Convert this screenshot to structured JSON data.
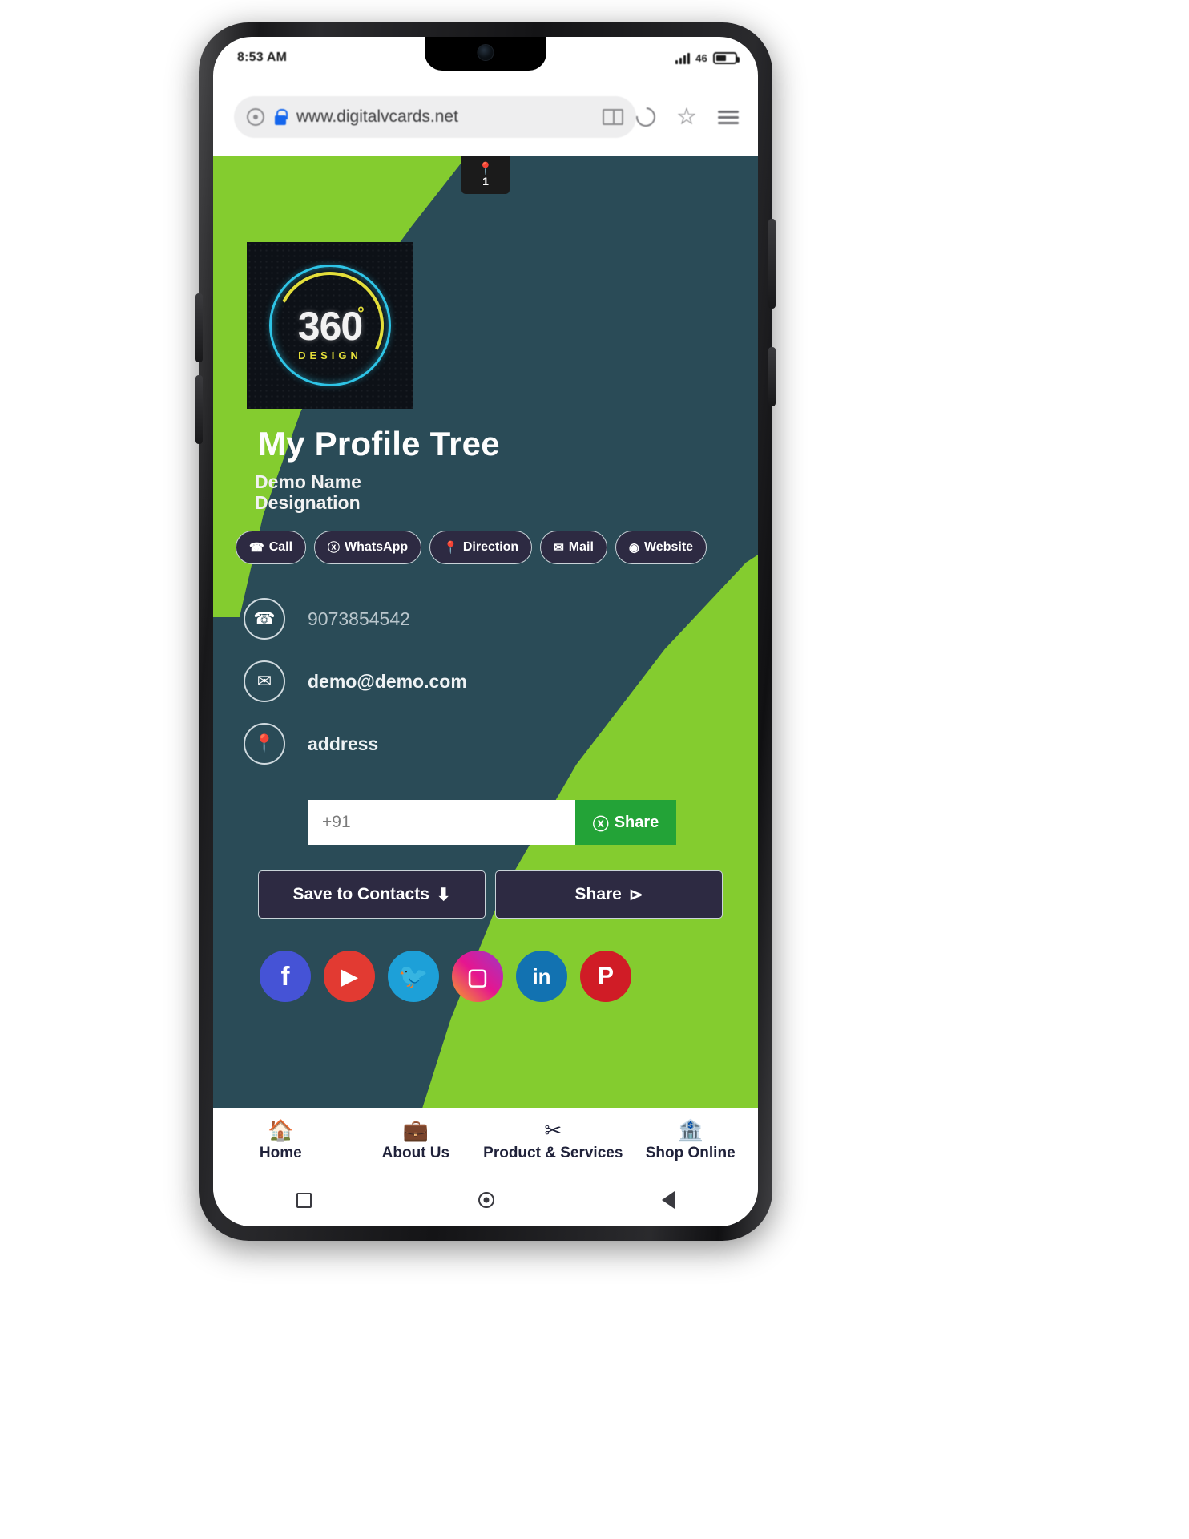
{
  "status_bar": {
    "time": "8:53 AM",
    "network_label": "46",
    "signal_icon": "signal-bars-icon",
    "battery_icon": "battery-icon"
  },
  "browser": {
    "url": "www.digitalvcards.net",
    "security_icon": "lock-icon",
    "reader_icon": "reader-mode-icon",
    "reload_icon": "reload-icon",
    "bookmark_icon": "star-icon",
    "menu_icon": "list-menu-icon",
    "site_info_icon": "site-info-icon"
  },
  "card": {
    "view_counter": {
      "icon": "pin-icon",
      "count": "1"
    },
    "logo": {
      "text": "360",
      "degree": "°",
      "subtitle": "DESIGN",
      "alt": "360-design-logo"
    },
    "title": "My Profile Tree",
    "name": "Demo Name",
    "designation": "Designation",
    "colors": {
      "green": "#84cc2f",
      "teal": "#2a4b57",
      "pill": "#2d2a42",
      "whatsapp_green": "#23a337"
    },
    "actions": [
      {
        "label": "Call",
        "icon": "phone-icon",
        "glyph": "✆"
      },
      {
        "label": "WhatsApp",
        "icon": "whatsapp-icon",
        "glyph": "ⓦ"
      },
      {
        "label": "Direction",
        "icon": "location-icon",
        "glyph": "⚑"
      },
      {
        "label": "Mail",
        "icon": "envelope-icon",
        "glyph": "✉"
      },
      {
        "label": "Website",
        "icon": "globe-icon",
        "glyph": "⊕"
      }
    ],
    "contacts": [
      {
        "icon": "phone-icon",
        "glyph": "☎",
        "value": "9073854542",
        "muted": true
      },
      {
        "icon": "envelope-icon",
        "glyph": "✉",
        "value": "demo@demo.com",
        "muted": false
      },
      {
        "icon": "location-icon",
        "glyph": "⌖",
        "value": "address",
        "muted": false
      }
    ],
    "share_input": {
      "value": "+91",
      "placeholder": "+91",
      "button_label": "Share",
      "button_icon": "whatsapp-icon"
    },
    "buttons": [
      {
        "label": "Save to Contacts",
        "icon": "download-icon",
        "glyph": "⤓"
      },
      {
        "label": "Share",
        "icon": "share-icon",
        "glyph": "☲"
      }
    ],
    "social": [
      {
        "name": "facebook-icon",
        "glyph": "f",
        "color": "#4553d6"
      },
      {
        "name": "youtube-icon",
        "glyph": "▶",
        "color": "#e23a32"
      },
      {
        "name": "twitter-icon",
        "glyph": "ᴠ",
        "color": "#1da0d8"
      },
      {
        "name": "instagram-icon",
        "glyph": "▣",
        "color": "#e6158f"
      },
      {
        "name": "linkedin-icon",
        "glyph": "in",
        "color": "#1272b1"
      },
      {
        "name": "pinterest-icon",
        "glyph": "P",
        "color": "#d01c26"
      }
    ]
  },
  "app_nav": [
    {
      "label": "Home",
      "icon": "home-icon",
      "glyph": "⌂"
    },
    {
      "label": "About Us",
      "icon": "briefcase-icon",
      "glyph": "Ὃc"
    },
    {
      "label": "Product & Services",
      "icon": "tools-icon",
      "glyph": "✂"
    },
    {
      "label": "Shop Online",
      "icon": "store-icon",
      "glyph": "▤"
    }
  ],
  "system_nav": [
    {
      "name": "recents-button",
      "icon": "square-icon"
    },
    {
      "name": "home-button",
      "icon": "circle-icon"
    },
    {
      "name": "back-button",
      "icon": "triangle-icon"
    }
  ]
}
